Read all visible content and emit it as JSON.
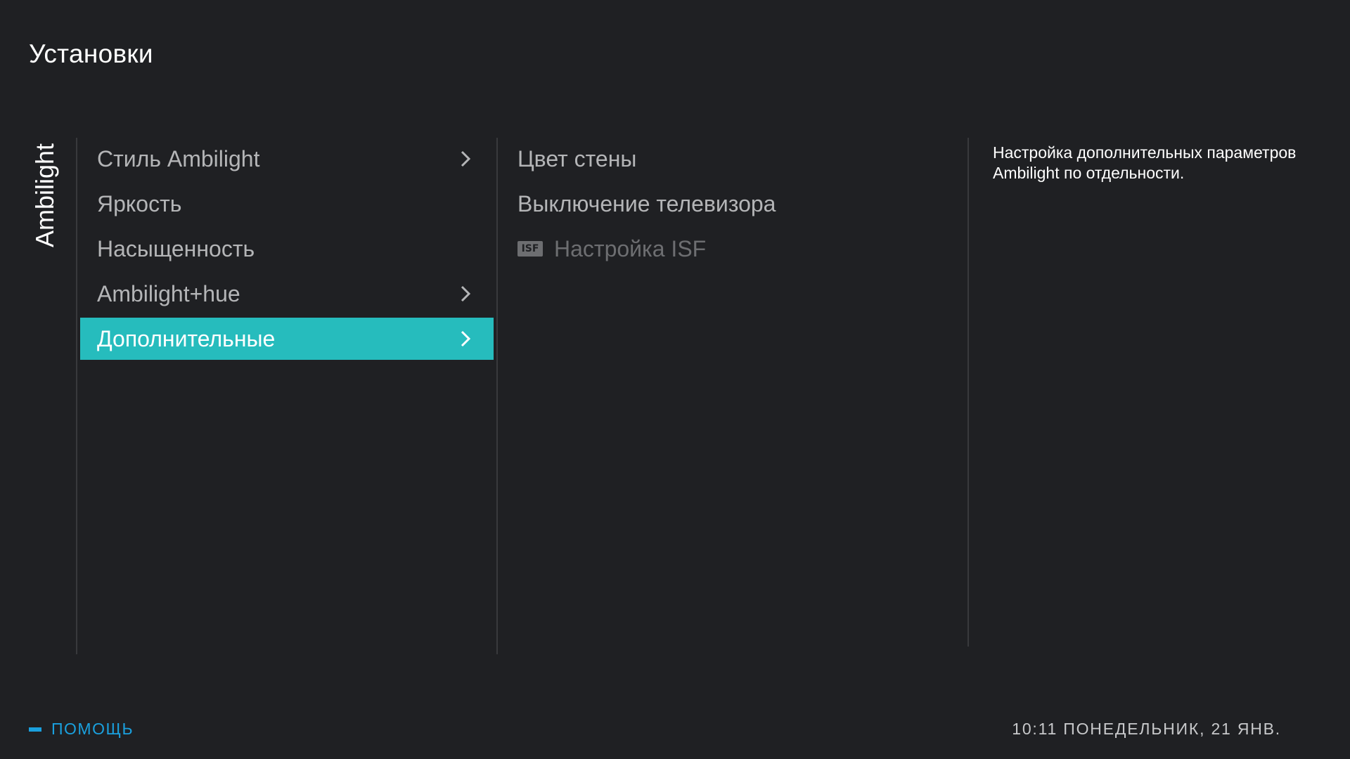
{
  "header": {
    "title": "Установки"
  },
  "section": {
    "label": "Ambilight"
  },
  "menu": {
    "items": [
      {
        "label": "Стиль Ambilight",
        "has_submenu": true,
        "selected": false
      },
      {
        "label": "Яркость",
        "has_submenu": false,
        "selected": false
      },
      {
        "label": "Насыщенность",
        "has_submenu": false,
        "selected": false
      },
      {
        "label": "Ambilight+hue",
        "has_submenu": true,
        "selected": false
      },
      {
        "label": "Дополнительные",
        "has_submenu": true,
        "selected": true
      }
    ]
  },
  "submenu": {
    "items": [
      {
        "label": "Цвет стены",
        "enabled": true
      },
      {
        "label": "Выключение телевизора",
        "enabled": true
      },
      {
        "label": "Настройка ISF",
        "enabled": false,
        "badge": "ISF"
      }
    ]
  },
  "description": {
    "text": "Настройка дополнительных параметров Ambilight по отдельности."
  },
  "footer": {
    "help_label": "ПОМОЩЬ",
    "clock": "10:11 ПОНЕДЕЛЬНИК, 21 ЯНВ."
  },
  "colors": {
    "background": "#1f2023",
    "selection": "#26bcbd",
    "help_accent": "#1aa0de"
  },
  "icons": {
    "chevron": "chevron-right-icon",
    "help_key": "help-key-icon"
  }
}
